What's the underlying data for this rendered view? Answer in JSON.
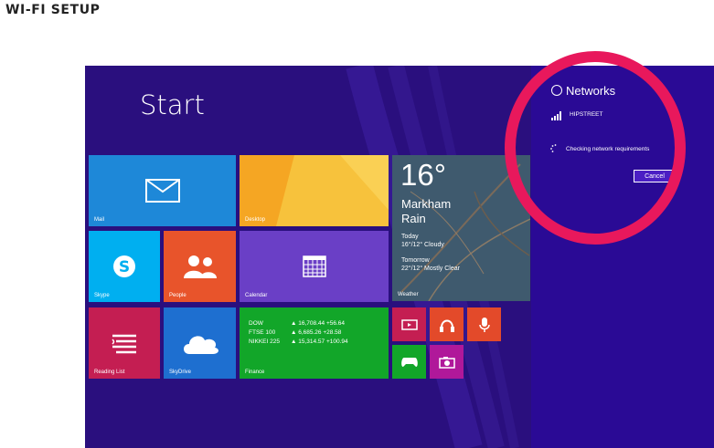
{
  "page": {
    "heading": "WI-FI SETUP"
  },
  "start": {
    "title": "Start"
  },
  "tiles": {
    "mail": "Mail",
    "desktop": "Desktop",
    "skype": "Skype",
    "people": "People",
    "calendar": "Calendar",
    "reading_list": "Reading List",
    "skydrive": "SkyDrive",
    "finance": "Finance",
    "weather": "Weather"
  },
  "weather": {
    "temp": "16°",
    "city": "Markham",
    "condition": "Rain",
    "today_label": "Today",
    "today_forecast": "16°/12° Cloudy",
    "tomorrow_label": "Tomorrow",
    "tomorrow_forecast": "22°/12° Mostly Clear"
  },
  "finance": {
    "rows": [
      {
        "name": "DOW",
        "value": "▲ 16,708.44 +56.64"
      },
      {
        "name": "FTSE 100",
        "value": "▲ 6,685.26 +28.58"
      },
      {
        "name": "NIKKEI 225",
        "value": "▲ 15,314.57 +100.94"
      }
    ]
  },
  "networks": {
    "title": "Networks",
    "network_name": "HIPSTREET",
    "status": "Checking network requirements",
    "cancel_label": "Cancel"
  },
  "colors": {
    "background": "#2a0f7e",
    "highlight_ring": "#e8185c",
    "mail": "#1e88d8",
    "desktop": "#f5a623",
    "skype": "#00aff0",
    "people": "#e8542b",
    "calendar": "#6a3fc6",
    "reading_list": "#c41e52",
    "skydrive": "#1e6fd0",
    "finance": "#12a629",
    "small_tiles": "#e34a2a",
    "video": "#c41e52",
    "games": "#12a629",
    "camera": "#b0189a"
  }
}
